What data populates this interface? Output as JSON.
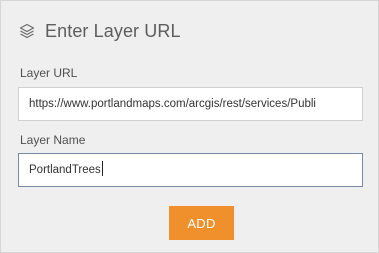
{
  "header": {
    "icon": "layers-icon",
    "title": "Enter Layer URL"
  },
  "form": {
    "url_label": "Layer URL",
    "url_value": "https://www.portlandmaps.com/arcgis/rest/services/Publi",
    "name_label": "Layer Name",
    "name_value": "PortlandTrees",
    "add_label": "ADD"
  },
  "colors": {
    "panel_bg": "#efefef",
    "accent_button": "#f0902c",
    "focused_border": "#7a8aa4"
  }
}
